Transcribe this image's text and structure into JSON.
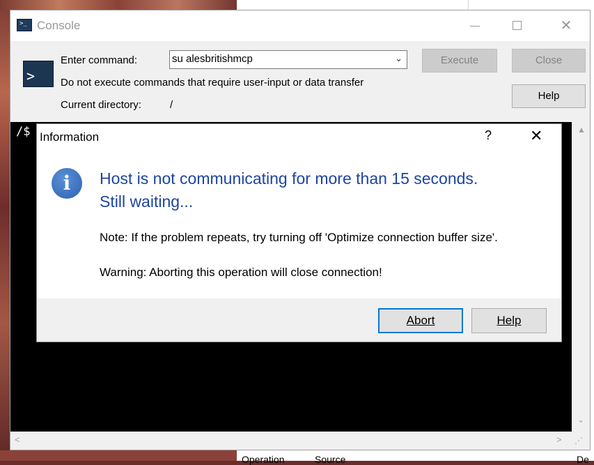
{
  "console": {
    "title": "Console",
    "icon": "console-icon",
    "enter_command_label": "Enter command:",
    "command_value": "su alesbritishmcp",
    "note": "Do not execute commands that require user-input or data transfer",
    "current_directory_label": "Current directory:",
    "current_directory_value": "/",
    "execute_label": "Execute",
    "close_label": "Close",
    "help_label": "Help",
    "terminal_prompt": "/$"
  },
  "dialog": {
    "title": "Information",
    "help_glyph": "?",
    "close_glyph": "✕",
    "message_line1": "Host is not communicating for more than 15 seconds.",
    "message_line2": "Still waiting...",
    "note": "Note: If the problem repeats, try turning off 'Optimize connection buffer size'.",
    "warning": "Warning: Aborting this operation will close connection!",
    "abort_label": "Abort",
    "help_label": "Help",
    "accent_color": "#1e45a0"
  },
  "background": {
    "column_operation": "Operation",
    "column_source": "Source",
    "column_de": "De"
  }
}
